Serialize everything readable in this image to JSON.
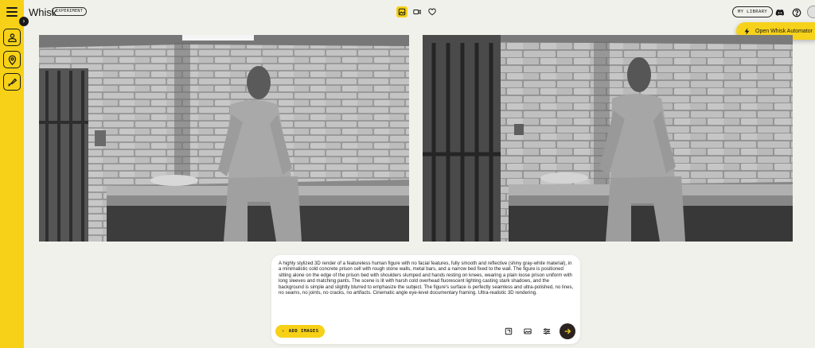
{
  "app": {
    "title": "Whisk",
    "badge": "EXPERIMENT"
  },
  "header": {
    "my_library_label": "MY LIBRARY",
    "center_icons": [
      "image-mode-icon",
      "video-mode-icon",
      "favorites-heart-icon"
    ],
    "right_icons": [
      "discord-icon",
      "help-icon",
      "avatar"
    ]
  },
  "automator": {
    "label": "Open Whisk Automator"
  },
  "sidebar": {
    "tools": [
      "subject-person-icon",
      "scene-location-icon",
      "style-brush-icon"
    ]
  },
  "prompt": {
    "text": "A highly stylized 3D render of a featureless human figure with no facial features, fully smooth and reflective (shiny gray-white material), in a minimalistic cold concrete prison cell with rough stone walls, metal bars, and a narrow bed fixed to the wall. The figure is positioned sitting alone on the edge of the prison bed with shoulders slumped and hands resting on knees, wearing a plain loose prison uniform with long sleeves and matching pants. The scene is lit with harsh cold overhead fluorescent lighting casting stark shadows, and the background is simple and slightly blurred to emphasize the subject. The figure's surface is perfectly seamless and ultra-polished, no lines, no seams, no joints, no cracks, no artifacts. Cinematic angle eye-level documentary framing. Ultra-realistic 3D rendering.",
    "add_images_label": "ADD IMAGES",
    "tool_icons": [
      "aspect-ratio-icon",
      "image-format-icon",
      "settings-sliders-icon"
    ]
  },
  "colors": {
    "accent": "#f6d117",
    "background": "#f1f1ec",
    "submit": "#2a2320"
  }
}
